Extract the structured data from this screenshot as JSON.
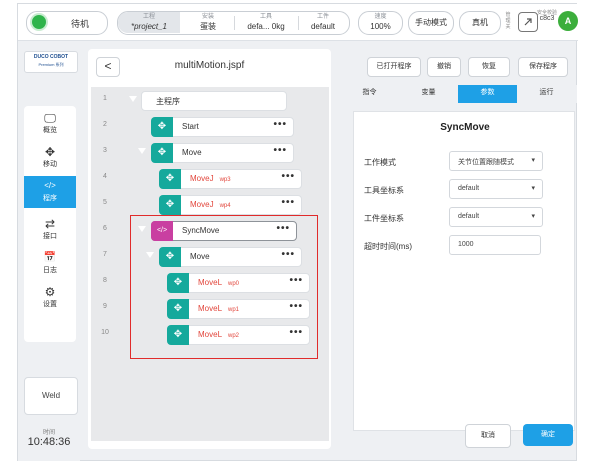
{
  "topbar": {
    "status": "待机",
    "project": {
      "key": "工程",
      "value": "*project_1"
    },
    "install": {
      "key": "安装",
      "value": "蛋装"
    },
    "tool": {
      "key": "工具",
      "value": "defa... 0kg"
    },
    "workpiece": {
      "key": "工件",
      "value": "default"
    },
    "speed": {
      "key": "速度",
      "value": "100%"
    },
    "manual_mode": "手动模式",
    "real_machine": "真机",
    "small_stack": "管\n理\n关",
    "safety": {
      "key": "安全校验",
      "code": "c8c3"
    },
    "avatar": "A",
    "colors": {
      "status_dot": "#2fb44b",
      "avatar": "#3cae3c"
    }
  },
  "sidebar": {
    "logo_main": "DUCO COBOT",
    "logo_sub": "Premium 系列",
    "items": [
      {
        "icon": "monitor-icon",
        "glyph": "🖵",
        "label": "概览"
      },
      {
        "icon": "move-icon",
        "glyph": "✥",
        "label": "移动"
      },
      {
        "icon": "code-icon",
        "glyph": "</>",
        "label": "程序"
      },
      {
        "icon": "swap-icon",
        "glyph": "⇄",
        "label": "接口"
      },
      {
        "icon": "calendar-icon",
        "glyph": "📅",
        "label": "日志"
      },
      {
        "icon": "gear-icon",
        "glyph": "⚙",
        "label": "设置"
      }
    ],
    "active_item": "程序",
    "weld": "Weld",
    "time_label": "时间",
    "time": "10:48:36"
  },
  "program": {
    "back": "<",
    "filename": "multiMotion.jspf",
    "rows": [
      {
        "line": "1",
        "name": "主程序",
        "kind": "root"
      },
      {
        "line": "2",
        "name": "Start",
        "kind": "node"
      },
      {
        "line": "3",
        "name": "Move",
        "kind": "node"
      },
      {
        "line": "4",
        "name": "MoveJ",
        "wp": "wp3",
        "kind": "motion"
      },
      {
        "line": "5",
        "name": "MoveJ",
        "wp": "wp4",
        "kind": "motion"
      },
      {
        "line": "6",
        "name": "SyncMove",
        "kind": "sync"
      },
      {
        "line": "7",
        "name": "Move",
        "kind": "node"
      },
      {
        "line": "8",
        "name": "MoveL",
        "wp": "wp0",
        "kind": "motion"
      },
      {
        "line": "9",
        "name": "MoveL",
        "wp": "wp1",
        "kind": "motion"
      },
      {
        "line": "10",
        "name": "MoveL",
        "wp": "wp2",
        "kind": "motion"
      }
    ],
    "dots": "•••",
    "move_glyph": "✥",
    "sync_glyph": "</>"
  },
  "right": {
    "buttons": {
      "opened": "已打开程序",
      "undo": "撤销",
      "redo": "恢复",
      "save": "保存程序"
    },
    "tabs": [
      "指令",
      "变量",
      "参数",
      "运行"
    ],
    "active_tab": "参数",
    "title": "SyncMove",
    "params": [
      {
        "label": "工作模式",
        "value": "关节位置跟随模式",
        "caret": "▾"
      },
      {
        "label": "工具坐标系",
        "value": "default",
        "caret": "▾"
      },
      {
        "label": "工件坐标系",
        "value": "default",
        "caret": "▾"
      },
      {
        "label": "超时时间(ms)",
        "value": "1000",
        "caret": ""
      }
    ],
    "cancel": "取消",
    "confirm": "确定",
    "accent": "#1ea0e6"
  }
}
